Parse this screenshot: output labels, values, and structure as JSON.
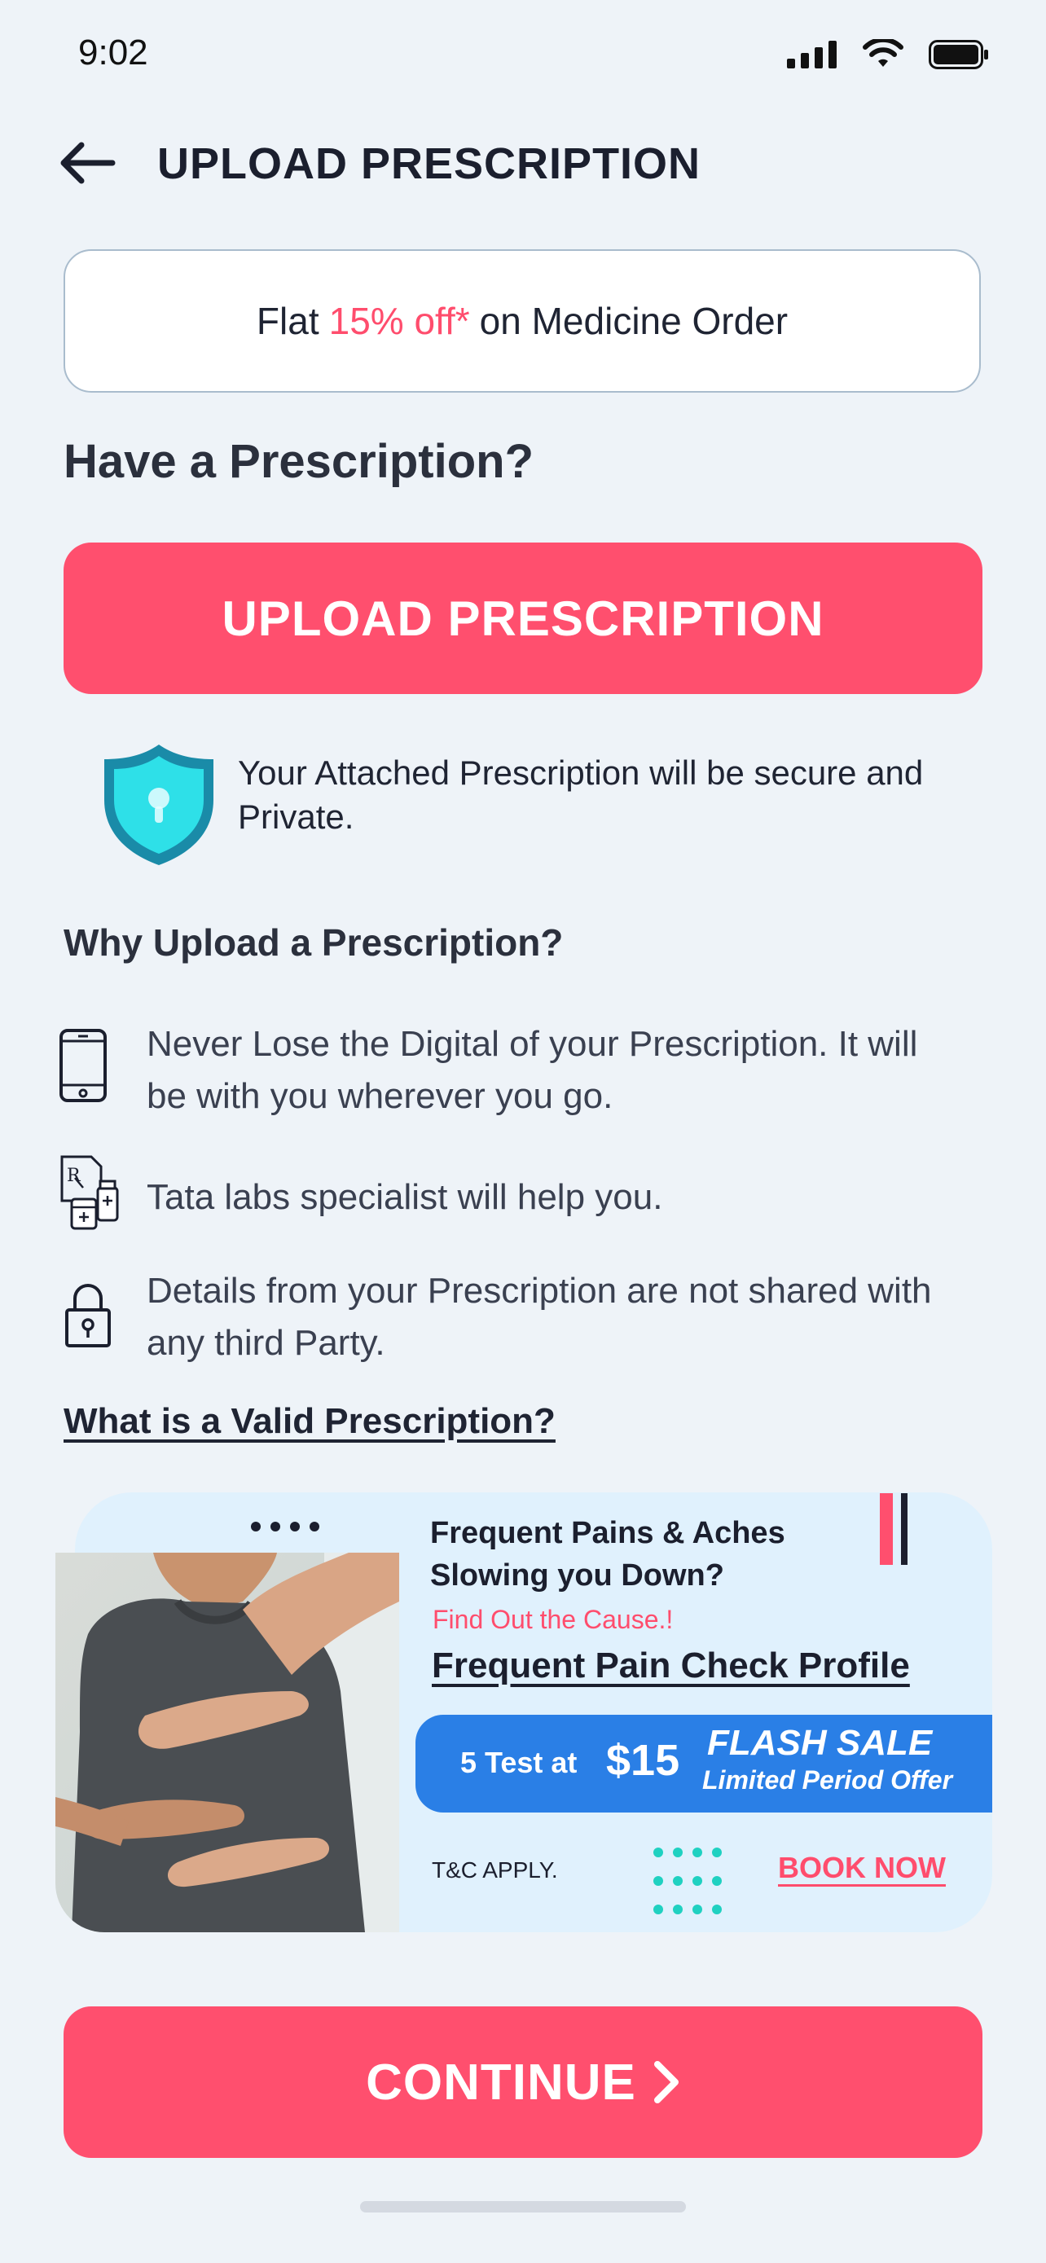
{
  "status_bar": {
    "time": "9:02"
  },
  "header": {
    "title": "UPLOAD PRESCRIPTION"
  },
  "offer": {
    "prefix": "Flat",
    "highlight": "15% off*",
    "suffix": "on Medicine Order",
    "highlight_color": "#ff4d6d"
  },
  "main": {
    "question": "Have a Prescription?",
    "upload_button": "UPLOAD PRESCRIPTION",
    "secure_text": "Your Attached Prescription will be secure and Private.",
    "why_title": "Why Upload a Prescription?",
    "benefits": [
      {
        "icon": "phone-icon",
        "text": "Never Lose the Digital of your Prescription. It will be with you wherever you go."
      },
      {
        "icon": "prescription-medicine-icon",
        "text": "Tata labs specialist will help you."
      },
      {
        "icon": "lock-icon",
        "text": "Details from your Prescription are not shared with any third Party."
      }
    ],
    "valid_link": "What is a Valid Prescription?"
  },
  "promo": {
    "headline": "Frequent Pains & Aches Slowing you Down?",
    "cause": "Find Out the Cause.!",
    "profile": "Frequent Pain Check Profile",
    "tests": "5 Test at",
    "price": "$15",
    "flash_sale": "FLASH SALE",
    "limited": "Limited Period Offer",
    "tc": "T&C APPLY.",
    "book_now": "BOOK NOW",
    "photo_icon": "back-pain-photo"
  },
  "footer": {
    "continue": "CONTINUE"
  },
  "colors": {
    "accent": "#ff4f6e",
    "blue": "#2a7fe6",
    "teal": "#1fd1c1",
    "background": "#eef3f8"
  }
}
